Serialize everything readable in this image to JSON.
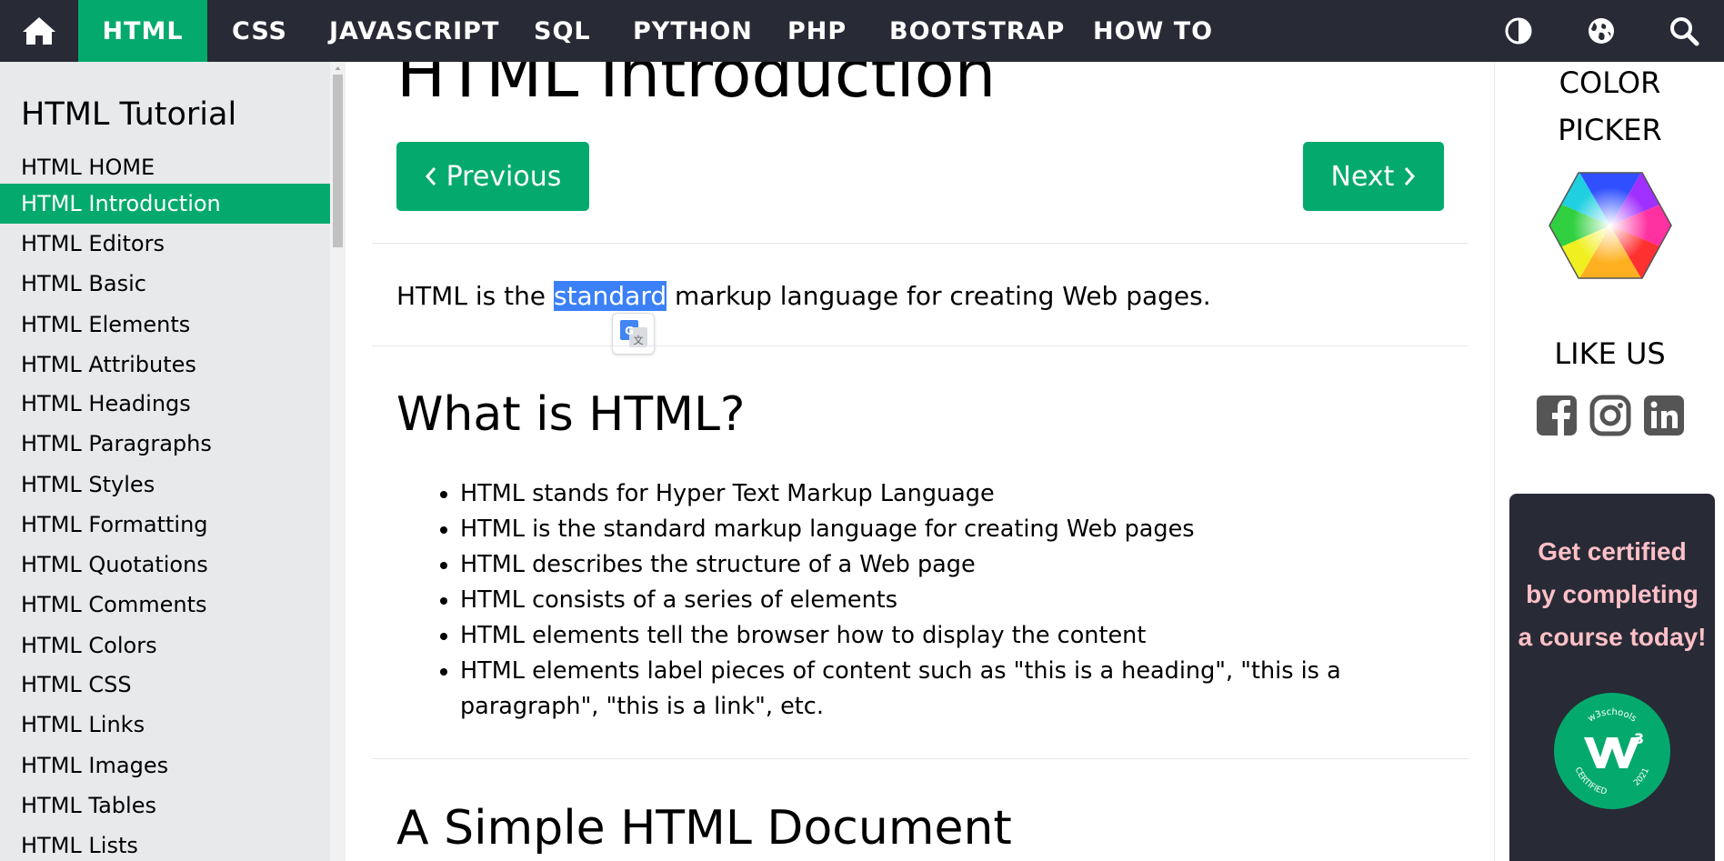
{
  "topnav": {
    "items": [
      {
        "label": "HTML",
        "active": true
      },
      {
        "label": "CSS"
      },
      {
        "label": "JAVASCRIPT"
      },
      {
        "label": "SQL"
      },
      {
        "label": "PYTHON"
      },
      {
        "label": "PHP"
      },
      {
        "label": "BOOTSTRAP"
      },
      {
        "label": "HOW TO"
      }
    ],
    "icons": [
      "home-icon",
      "contrast-icon",
      "globe-icon",
      "search-icon"
    ]
  },
  "sidebar": {
    "title": "HTML Tutorial",
    "items": [
      {
        "label": "HTML HOME"
      },
      {
        "label": "HTML Introduction",
        "active": true
      },
      {
        "label": "HTML Editors"
      },
      {
        "label": "HTML Basic"
      },
      {
        "label": "HTML Elements"
      },
      {
        "label": "HTML Attributes"
      },
      {
        "label": "HTML Headings"
      },
      {
        "label": "HTML Paragraphs"
      },
      {
        "label": "HTML Styles"
      },
      {
        "label": "HTML Formatting"
      },
      {
        "label": "HTML Quotations"
      },
      {
        "label": "HTML Comments"
      },
      {
        "label": "HTML Colors"
      },
      {
        "label": "HTML CSS"
      },
      {
        "label": "HTML Links"
      },
      {
        "label": "HTML Images"
      },
      {
        "label": "HTML Tables"
      },
      {
        "label": "HTML Lists"
      }
    ]
  },
  "main": {
    "title": "HTML Introduction",
    "prev_label": "Previous",
    "next_label": "Next",
    "intro": {
      "before": "HTML is the ",
      "selected": "standard",
      "after": " markup language for creating Web pages."
    },
    "section1_title": "What is HTML?",
    "bullets": [
      "HTML stands for Hyper Text Markup Language",
      "HTML is the standard markup language for creating Web pages",
      "HTML describes the structure of a Web page",
      "HTML consists of a series of elements",
      "HTML elements tell the browser how to display the content",
      "HTML elements label pieces of content such as \"this is a heading\", \"this is a paragraph\", \"this is a link\", etc."
    ],
    "section2_title": "A Simple HTML Document"
  },
  "right": {
    "color_picker_line1": "COLOR",
    "color_picker_line2": "PICKER",
    "like_us": "LIKE US",
    "cert_line1": "Get certified",
    "cert_line2": "by completing",
    "cert_line3": "a course today!",
    "badge_top": "w3schools",
    "badge_bottom": "CERTIFIED",
    "badge_year": "2021",
    "badge_mark": "3"
  },
  "colors": {
    "nav_bg": "#282A35",
    "accent": "#04AA6D",
    "sidebar_bg": "#E7E9EB",
    "selection": "#3B80F7",
    "cert_text": "#FFC0C7"
  }
}
